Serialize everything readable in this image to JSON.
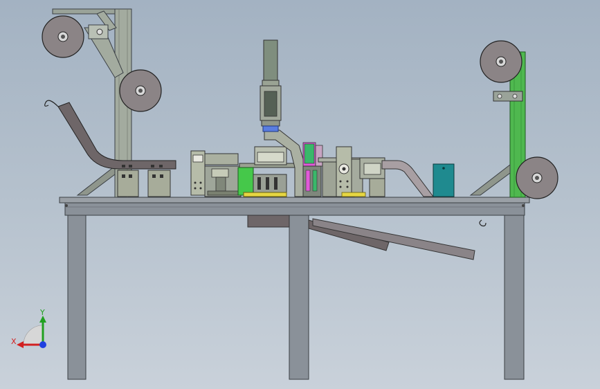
{
  "viewport": {
    "background_top": "#a3b2c2",
    "background_bottom": "#c9d1da"
  },
  "model": {
    "frame_color": "#8a9199",
    "frame_edge": "#3a3f44",
    "green_part_color": "#4fb84f",
    "teal_part_color": "#1f8a8f",
    "yellow_part_color": "#e6d642",
    "roll_color": "#8b8486",
    "dark_guide_color": "#6e6668"
  },
  "triad": {
    "x_label": "X",
    "y_label": "Y",
    "x_color": "#d22020",
    "y_color": "#20a020",
    "z_color": "#2040e0",
    "icon": "coordinate-triad-icon"
  }
}
